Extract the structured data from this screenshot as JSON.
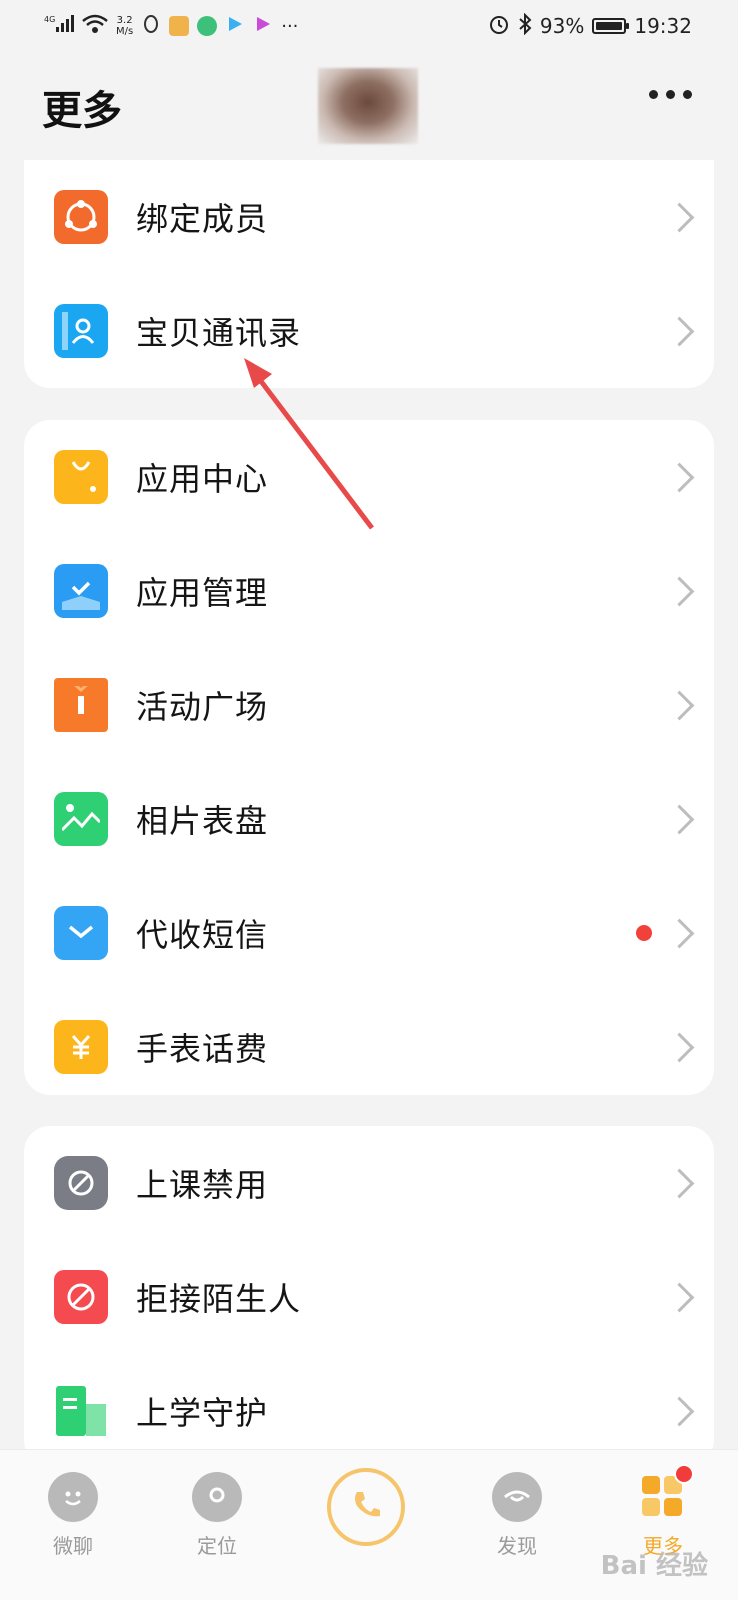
{
  "status_bar": {
    "network": "4G",
    "speed": "3.2\nM/s",
    "battery": "93%",
    "time": "19:32",
    "more": "···"
  },
  "header": {
    "title": "更多"
  },
  "card1": {
    "items": [
      {
        "label": "绑定成员",
        "icon": "members-icon",
        "color": "#f36b2c"
      },
      {
        "label": "宝贝通讯录",
        "icon": "contacts-icon",
        "color": "#1aa6f0"
      }
    ]
  },
  "card2": {
    "items": [
      {
        "label": "应用中心",
        "icon": "shopping-bag-icon",
        "color": "#fdb51c"
      },
      {
        "label": "应用管理",
        "icon": "check-ribbon-icon",
        "color": "#2a9cf4"
      },
      {
        "label": "活动广场",
        "icon": "gift-icon",
        "color": "#f7792a"
      },
      {
        "label": "相片表盘",
        "icon": "photo-icon",
        "color": "#2fcf74"
      },
      {
        "label": "代收短信",
        "icon": "mail-icon",
        "color": "#34a5f5",
        "has_badge": true
      },
      {
        "label": "手表话费",
        "icon": "yuan-icon",
        "color": "#fdb51c"
      }
    ]
  },
  "card3": {
    "items": [
      {
        "label": "上课禁用",
        "icon": "watch-forbid-icon",
        "color": "#7a7d86"
      },
      {
        "label": "拒接陌生人",
        "icon": "reject-call-icon",
        "color": "#f44a50"
      },
      {
        "label": "上学守护",
        "icon": "school-guard-icon",
        "color": "#2fcf74"
      }
    ]
  },
  "bottom_nav": {
    "items": [
      {
        "label": "微聊",
        "icon": "chat-face-icon"
      },
      {
        "label": "定位",
        "icon": "location-icon"
      },
      {
        "label": "",
        "icon": "phone-call-icon"
      },
      {
        "label": "发现",
        "icon": "discover-eye-icon"
      },
      {
        "label": "更多",
        "icon": "more-grid-icon",
        "active": true
      }
    ]
  },
  "watermark": "Bai 经验"
}
